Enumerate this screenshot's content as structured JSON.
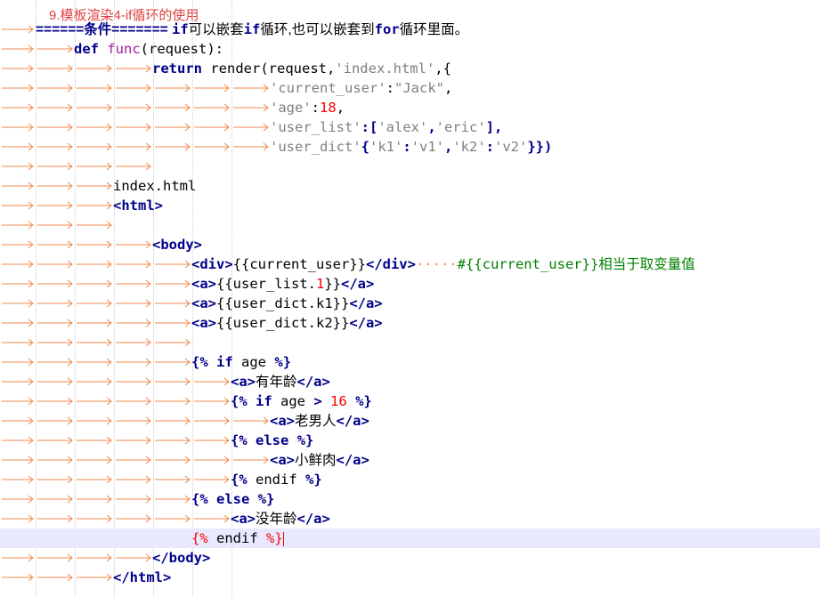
{
  "title": "9.模板渲染4-if循环的使用",
  "colors": {
    "tab_arrow": "#f08a4b",
    "keyword": "#00008b",
    "string": "#808080",
    "number": "#ff0000",
    "comment": "#008000",
    "function": "#a020a0",
    "title": "#e04040",
    "current_line": "#e8e8ff"
  },
  "lines": {
    "l1": {
      "p1": "======条件======= ",
      "p2": "if",
      "p3": "可以嵌套",
      "p4": "if",
      "p5": "循环,也可以嵌套到",
      "p6": "for",
      "p7": "循环里面。"
    },
    "l2": {
      "p1": "def",
      "p2": " ",
      "p3": "func",
      "p4": "(request):"
    },
    "l3": {
      "p1": "return",
      "p2": " render(request,",
      "p3": "'index.html'",
      "p4": ",{"
    },
    "l4": {
      "p1": "'current_user'",
      "p2": ":",
      "p3": "\"Jack\"",
      "p4": ","
    },
    "l5": {
      "p1": "'age'",
      "p2": ":",
      "p3": "18",
      "p4": ","
    },
    "l6": {
      "p1": "'user_list'",
      "p2": ":[",
      "p3": "'alex'",
      "p4": ",",
      "p5": "'eric'",
      "p6": "],"
    },
    "l7": {
      "p1": "'user_dict'",
      "p2": "{",
      "p3": "'k1'",
      "p4": ":",
      "p5": "'v1'",
      "p6": ",",
      "p7": "'k2'",
      "p8": ":",
      "p9": "'v2'",
      "p10": "}})"
    },
    "l9": {
      "p1": "index.html"
    },
    "l10": {
      "p1": "<html>"
    },
    "l12": {
      "p1": "<body>"
    },
    "l13": {
      "p1": "<div>",
      "p2": "{{current_user}}",
      "p3": "</div>",
      "p4": "·····",
      "p5": "#{{current_user}}相当于取变量值"
    },
    "l14": {
      "p1": "<a>",
      "p2": "{{user_list.",
      "p3": "1",
      "p4": "}}",
      "p5": "</a>"
    },
    "l15": {
      "p1": "<a>",
      "p2": "{{user_dict.k1}}",
      "p3": "</a>"
    },
    "l16": {
      "p1": "<a>",
      "p2": "{{user_dict.k2}}",
      "p3": "</a>"
    },
    "l18": {
      "p1": "{%",
      "p2": " ",
      "p3": "if",
      "p4": " age ",
      "p5": "%}"
    },
    "l19": {
      "p1": "<a>",
      "p2": "有年龄",
      "p3": "</a>"
    },
    "l20": {
      "p1": "{%",
      "p2": " ",
      "p3": "if",
      "p4": " age ",
      "p5": ">",
      "p6": " ",
      "p7": "16",
      "p8": " ",
      "p9": "%}"
    },
    "l21": {
      "p1": "<a>",
      "p2": "老男人",
      "p3": "</a>"
    },
    "l22": {
      "p1": "{%",
      "p2": " ",
      "p3": "else",
      "p4": " ",
      "p5": "%}"
    },
    "l23": {
      "p1": "<a>",
      "p2": "小鲜肉",
      "p3": "</a>"
    },
    "l24": {
      "p1": "{%",
      "p2": " endif ",
      "p3": "%}"
    },
    "l25": {
      "p1": "{%",
      "p2": " ",
      "p3": "else",
      "p4": " ",
      "p5": "%}"
    },
    "l26": {
      "p1": "<a>",
      "p2": "没年龄",
      "p3": "</a>"
    },
    "l27": {
      "p1": "{%",
      "p2": " endif ",
      "p3": "%}"
    },
    "l28": {
      "p1": "</body>"
    },
    "l29": {
      "p1": "</html>"
    }
  }
}
